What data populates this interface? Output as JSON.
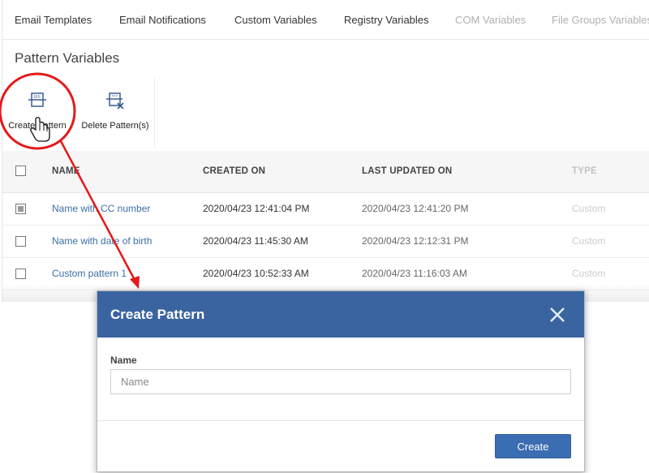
{
  "tabs": [
    {
      "label": "Email Templates"
    },
    {
      "label": "Email Notifications"
    },
    {
      "label": "Custom Variables"
    },
    {
      "label": "Registry Variables"
    },
    {
      "label": "COM Variables"
    },
    {
      "label": "File Groups Variables"
    }
  ],
  "page": {
    "title": "Pattern Variables"
  },
  "toolbar": {
    "create_label": "Create Pattern",
    "delete_label": "Delete Pattern(s)",
    "create_icon": "create-pattern-icon",
    "delete_icon": "delete-pattern-icon"
  },
  "table": {
    "headers": {
      "name": "NAME",
      "created": "CREATED ON",
      "updated": "LAST UPDATED ON",
      "type": "TYPE"
    },
    "rows": [
      {
        "name": "Name with CC number",
        "created": "2020/04/23 12:41:04 PM",
        "updated": "2020/04/23 12:41:20 PM",
        "type": "Custom",
        "checked": true
      },
      {
        "name": "Name with date of birth",
        "created": "2020/04/23 11:45:30 AM",
        "updated": "2020/04/23 12:12:31 PM",
        "type": "Custom",
        "checked": false
      },
      {
        "name": "Custom pattern 1",
        "created": "2020/04/23 10:52:33 AM",
        "updated": "2020/04/23 11:16:03 AM",
        "type": "Custom",
        "checked": false
      }
    ]
  },
  "modal": {
    "title": "Create Pattern",
    "name_label": "Name",
    "name_placeholder": "Name",
    "name_value": "",
    "create_label": "Create",
    "close_icon": "close-icon"
  },
  "colors": {
    "modal_header": "#3a64a0",
    "primary_button": "#3a6db1",
    "callout_red": "#e3191b",
    "link": "#3a6ea5"
  }
}
